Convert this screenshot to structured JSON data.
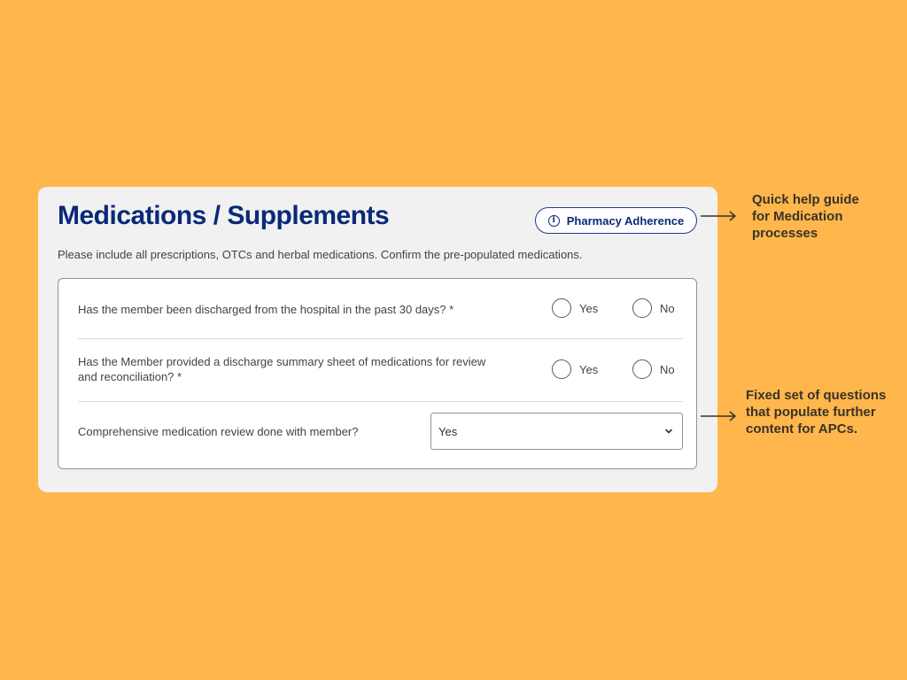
{
  "card": {
    "title": "Medications / Supplements",
    "help_button": {
      "icon": "info-icon",
      "label": "Pharmacy Adherence"
    },
    "subtitle": "Please include all prescriptions, OTCs and herbal medications. Confirm the pre-populated medications."
  },
  "questions": [
    {
      "text": "Has the member been discharged from the hospital in the past 30 days? *",
      "options": [
        "Yes",
        "No"
      ]
    },
    {
      "text": "Has the Member provided a discharge summary sheet of medications for review and reconciliation? *",
      "options": [
        "Yes",
        "No"
      ]
    },
    {
      "text": "Comprehensive medication review done with member?",
      "select_value": "Yes",
      "select_icon": "chevron-down-icon"
    }
  ],
  "annotations": [
    {
      "lines": [
        "Quick help guide",
        "for Medication",
        "processes"
      ]
    },
    {
      "lines": [
        "Fixed set of questions",
        "that populate further",
        "content for APCs."
      ]
    }
  ],
  "colors": {
    "background": "#FFB74D",
    "card": "#F1F1F2",
    "brand_navy": "#0A2A78",
    "annotation_text": "#3A3226"
  }
}
